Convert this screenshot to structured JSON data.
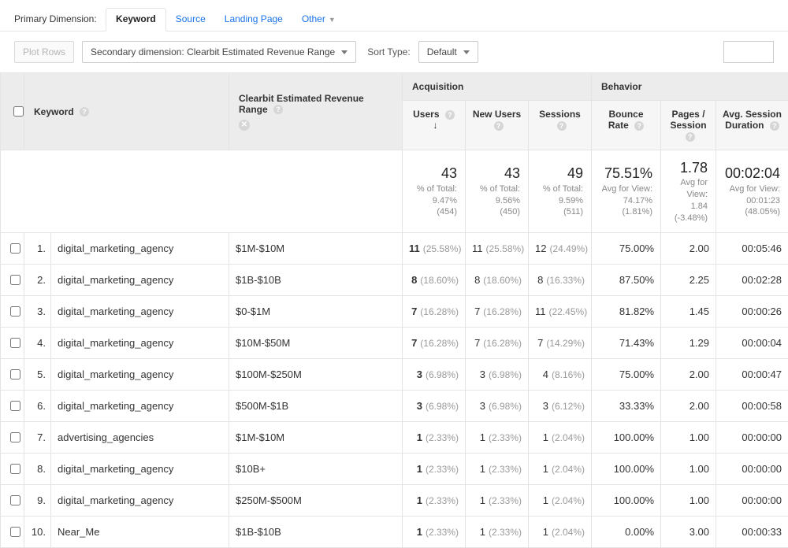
{
  "primaryDim": {
    "label": "Primary Dimension:",
    "tabs": [
      {
        "label": "Keyword",
        "active": true
      },
      {
        "label": "Source",
        "active": false
      },
      {
        "label": "Landing Page",
        "active": false
      },
      {
        "label": "Other",
        "active": false,
        "hasDropdown": true
      }
    ]
  },
  "toolbar": {
    "plotRows": "Plot Rows",
    "secondaryDim": "Secondary dimension: Clearbit Estimated Revenue Range",
    "sortTypeLabel": "Sort Type:",
    "sortTypeValue": "Default"
  },
  "groupHeaders": {
    "keyword": "Keyword",
    "revenue": "Clearbit Estimated Revenue Range",
    "acquisition": "Acquisition",
    "behavior": "Behavior"
  },
  "subHeaders": {
    "users": "Users",
    "newUsers": "New Users",
    "sessions": "Sessions",
    "bounce": "Bounce Rate",
    "pagesSession": "Pages / Session",
    "avgDur": "Avg. Session Duration"
  },
  "summary": {
    "users": {
      "big": "43",
      "l1": "% of Total:",
      "l2": "9.47% (454)"
    },
    "newUsers": {
      "big": "43",
      "l1": "% of Total:",
      "l2": "9.56% (450)"
    },
    "sessions": {
      "big": "49",
      "l1": "% of Total:",
      "l2": "9.59% (511)"
    },
    "bounce": {
      "big": "75.51%",
      "l1": "Avg for View:",
      "l2": "74.17%",
      "l3": "(1.81%)"
    },
    "pagesSession": {
      "big": "1.78",
      "l1": "Avg for",
      "l2": "View: 1.84",
      "l3": "(-3.48%)"
    },
    "avgDur": {
      "big": "00:02:04",
      "l1": "Avg for View:",
      "l2": "00:01:23",
      "l3": "(48.05%)"
    }
  },
  "rows": [
    {
      "idx": "1.",
      "keyword": "digital_marketing_agency",
      "revenue": "$1M-$10M",
      "users": {
        "v": "11",
        "p": "(25.58%)",
        "b": true
      },
      "newUsers": {
        "v": "11",
        "p": "(25.58%)"
      },
      "sessions": {
        "v": "12",
        "p": "(24.49%)"
      },
      "bounce": "75.00%",
      "ps": "2.00",
      "dur": "00:05:46"
    },
    {
      "idx": "2.",
      "keyword": "digital_marketing_agency",
      "revenue": "$1B-$10B",
      "users": {
        "v": "8",
        "p": "(18.60%)",
        "b": true
      },
      "newUsers": {
        "v": "8",
        "p": "(18.60%)"
      },
      "sessions": {
        "v": "8",
        "p": "(16.33%)"
      },
      "bounce": "87.50%",
      "ps": "2.25",
      "dur": "00:02:28"
    },
    {
      "idx": "3.",
      "keyword": "digital_marketing_agency",
      "revenue": "$0-$1M",
      "users": {
        "v": "7",
        "p": "(16.28%)",
        "b": true
      },
      "newUsers": {
        "v": "7",
        "p": "(16.28%)"
      },
      "sessions": {
        "v": "11",
        "p": "(22.45%)"
      },
      "bounce": "81.82%",
      "ps": "1.45",
      "dur": "00:00:26"
    },
    {
      "idx": "4.",
      "keyword": "digital_marketing_agency",
      "revenue": "$10M-$50M",
      "users": {
        "v": "7",
        "p": "(16.28%)",
        "b": true
      },
      "newUsers": {
        "v": "7",
        "p": "(16.28%)"
      },
      "sessions": {
        "v": "7",
        "p": "(14.29%)"
      },
      "bounce": "71.43%",
      "ps": "1.29",
      "dur": "00:00:04"
    },
    {
      "idx": "5.",
      "keyword": "digital_marketing_agency",
      "revenue": "$100M-$250M",
      "users": {
        "v": "3",
        "p": "(6.98%)",
        "b": true
      },
      "newUsers": {
        "v": "3",
        "p": "(6.98%)"
      },
      "sessions": {
        "v": "4",
        "p": "(8.16%)"
      },
      "bounce": "75.00%",
      "ps": "2.00",
      "dur": "00:00:47"
    },
    {
      "idx": "6.",
      "keyword": "digital_marketing_agency",
      "revenue": "$500M-$1B",
      "users": {
        "v": "3",
        "p": "(6.98%)",
        "b": true
      },
      "newUsers": {
        "v": "3",
        "p": "(6.98%)"
      },
      "sessions": {
        "v": "3",
        "p": "(6.12%)"
      },
      "bounce": "33.33%",
      "ps": "2.00",
      "dur": "00:00:58"
    },
    {
      "idx": "7.",
      "keyword": "advertising_agencies",
      "revenue": "$1M-$10M",
      "users": {
        "v": "1",
        "p": "(2.33%)",
        "b": true
      },
      "newUsers": {
        "v": "1",
        "p": "(2.33%)"
      },
      "sessions": {
        "v": "1",
        "p": "(2.04%)"
      },
      "bounce": "100.00%",
      "ps": "1.00",
      "dur": "00:00:00"
    },
    {
      "idx": "8.",
      "keyword": "digital_marketing_agency",
      "revenue": "$10B+",
      "users": {
        "v": "1",
        "p": "(2.33%)",
        "b": true
      },
      "newUsers": {
        "v": "1",
        "p": "(2.33%)"
      },
      "sessions": {
        "v": "1",
        "p": "(2.04%)"
      },
      "bounce": "100.00%",
      "ps": "1.00",
      "dur": "00:00:00"
    },
    {
      "idx": "9.",
      "keyword": "digital_marketing_agency",
      "revenue": "$250M-$500M",
      "users": {
        "v": "1",
        "p": "(2.33%)",
        "b": true
      },
      "newUsers": {
        "v": "1",
        "p": "(2.33%)"
      },
      "sessions": {
        "v": "1",
        "p": "(2.04%)"
      },
      "bounce": "100.00%",
      "ps": "1.00",
      "dur": "00:00:00"
    },
    {
      "idx": "10.",
      "keyword": "Near_Me",
      "revenue": "$1B-$10B",
      "users": {
        "v": "1",
        "p": "(2.33%)",
        "b": true
      },
      "newUsers": {
        "v": "1",
        "p": "(2.33%)"
      },
      "sessions": {
        "v": "1",
        "p": "(2.04%)"
      },
      "bounce": "0.00%",
      "ps": "3.00",
      "dur": "00:00:33"
    }
  ]
}
